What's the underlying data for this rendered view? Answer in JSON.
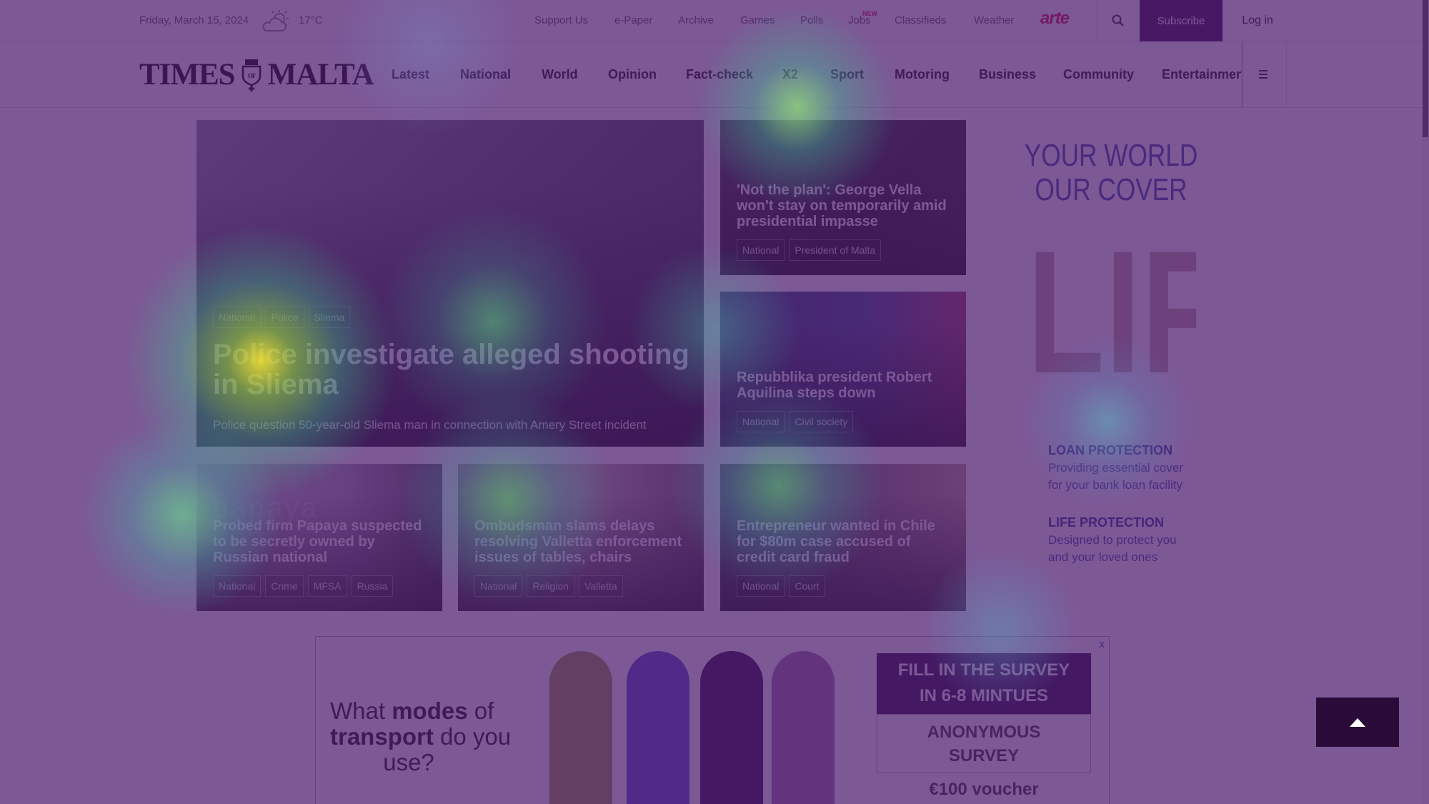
{
  "topbar": {
    "date": "Friday, March 15, 2024",
    "weather_icon": "partly-cloudy-icon",
    "temperature": "17°C",
    "links": [
      "Support Us",
      "e-Paper",
      "Archive",
      "Games",
      "Polls",
      "Jobs",
      "Classifieds",
      "Weather"
    ],
    "jobs_badge": "NEW",
    "arte": "arte",
    "subscribe": "Subscribe",
    "login": "Log in"
  },
  "logo": {
    "left": "TIMES",
    "right": "MALTA",
    "crest": "OF"
  },
  "nav": [
    "Latest",
    "National",
    "World",
    "Opinion",
    "Fact-check",
    "X2",
    "Sport",
    "Motoring",
    "Business",
    "Community",
    "Entertainment"
  ],
  "featured": {
    "tags": [
      "National",
      "Police",
      "Sliema"
    ],
    "headline": "Police investigate alleged shooting in Sliema",
    "subtitle": "Police question 50-year-old Sliema man in connection with Amery Street incident"
  },
  "side_articles": [
    {
      "headline": "'Not the plan': George Vella won't stay on temporarily amid presidential impasse",
      "tags": [
        "National",
        "President of Malta"
      ]
    },
    {
      "headline": "Repubblika president Robert Aquilina steps down",
      "tags": [
        "National",
        "Civil society"
      ]
    }
  ],
  "bottom_articles": [
    {
      "headline": "Probed firm Papaya suspected to be secretly owned by Russian national",
      "tags": [
        "National",
        "Crime",
        "MFSA",
        "Russia"
      ],
      "image_text": "papaya"
    },
    {
      "headline": "Ombudsman slams delays resolving Valletta enforcement issues of tables, chairs",
      "tags": [
        "National",
        "Religion",
        "Valletta"
      ]
    },
    {
      "headline": "Entrepreneur wanted in Chile for $80m case accused of credit card fraud",
      "tags": [
        "National",
        "Court"
      ]
    }
  ],
  "side_ad": {
    "line1": "YOUR WORLD",
    "line2": "OUR COVER",
    "big": "LIFE",
    "items": [
      {
        "title": "LOAN PROTECTION",
        "l1": "Providing essential cover",
        "l2": "for your bank loan facility"
      },
      {
        "title": "LIFE PROTECTION",
        "l1": "Designed to protect you",
        "l2": "and your loved ones"
      }
    ]
  },
  "bottom_ad": {
    "q1": "What ",
    "q_bold1": "modes",
    "q2": " of",
    "q_bold2": "transport",
    "q3": " do you",
    "q4": "use?",
    "cta1": "FILL IN THE SURVEY",
    "cta2": "IN 6-8 MINTUES",
    "anon1": "ANONYMOUS",
    "anon2": "SURVEY",
    "voucher": "€100 voucher",
    "close": "x"
  },
  "colors": {
    "subscribe_bg": "#3a0a42",
    "arte": "#e3123c",
    "overlay": "#4e1e70"
  }
}
